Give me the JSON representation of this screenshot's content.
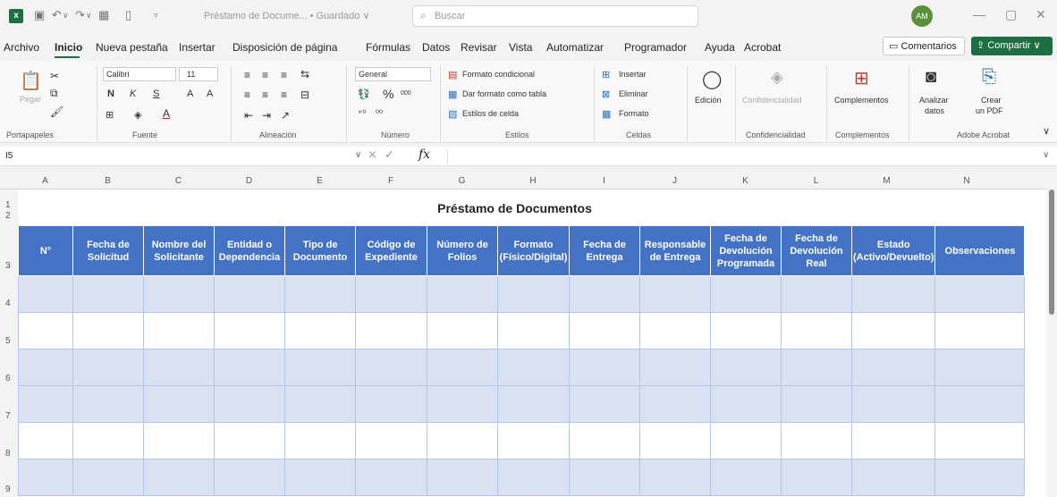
{
  "titlebar": {
    "doc_title": "Préstamo de Docume... • Guardado ∨",
    "search_placeholder": "Buscar",
    "avatar_initials": "AM"
  },
  "menu": {
    "tabs": [
      "Archivo",
      "Inicio",
      "Nueva pestaña",
      "Insertar",
      "Disposición de página",
      "Fórmulas",
      "Datos",
      "Revisar",
      "Vista",
      "Automatizar",
      "Programador",
      "Ayuda",
      "Acrobat"
    ],
    "active_tab": "Inicio",
    "comentarios": "Comentarios",
    "compartir": "Compartir"
  },
  "ribbon": {
    "pegar": "Pegar",
    "font_name": "Calibri",
    "font_size": "11",
    "bold": "N",
    "italic": "K",
    "underline": "S",
    "grow": "A",
    "shrink": "A",
    "number_format": "General",
    "percent": "%",
    "thousands": "000",
    "formato_condicional": "Formato condicional",
    "formato_tabla": "Dar formato como tabla",
    "estilos_celda": "Estilos de celda",
    "insertar": "Insertar",
    "eliminar": "Eliminar",
    "formato": "Formato",
    "edicion": "Edición",
    "confidencialidad": "Confidencialidad",
    "complementos": "Complementos",
    "analizar_line1": "Analizar",
    "analizar_line2": "datos",
    "crear_line1": "Crear",
    "crear_line2": "un PDF",
    "groups": {
      "portapapeles": "Portapapeles",
      "fuente": "Fuente",
      "alineacion": "Alineación",
      "numero": "Número",
      "estilos": "Estilos",
      "celdas": "Celdas",
      "confidencialidad": "Confidencialidad",
      "complementos": "Complementos",
      "adobe": "Adobe Acrobat"
    }
  },
  "formula_bar": {
    "name_box": "I5",
    "fx": "fx",
    "value": ""
  },
  "columns": [
    "A",
    "B",
    "C",
    "D",
    "E",
    "F",
    "G",
    "H",
    "I",
    "J",
    "K",
    "L",
    "M",
    "N"
  ],
  "rows": [
    "1",
    "2",
    "3",
    "4",
    "5",
    "6",
    "7",
    "8",
    "9"
  ],
  "sheet": {
    "title": "Préstamo de Documentos",
    "headers": [
      "N°",
      "Fecha de Solicitud",
      "Nombre del Solicitante",
      "Entidad o Dependencia",
      "Tipo de Documento",
      "Código de Expediente",
      "Número de Folios",
      "Formato (Físico/Digital)",
      "Fecha de Entrega",
      "Responsable de Entrega",
      "Fecha de Devolución Programada",
      "Fecha de Devolución Real",
      "Estado (Activo/Devuelto)",
      "Observaciones"
    ]
  }
}
